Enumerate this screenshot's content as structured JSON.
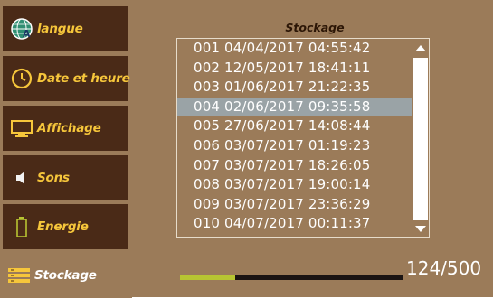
{
  "sidebar": {
    "items": [
      {
        "label": "langue",
        "icon": "globe-language-icon"
      },
      {
        "label": "Date et heure",
        "icon": "clock-icon"
      },
      {
        "label": "Affichage",
        "icon": "monitor-icon"
      },
      {
        "label": "Sons",
        "icon": "speaker-icon"
      },
      {
        "label": "Energie",
        "icon": "battery-icon"
      },
      {
        "label": "Stockage",
        "icon": "storage-list-icon",
        "active": true
      }
    ]
  },
  "main": {
    "title": "Stockage",
    "records": [
      "001 04/04/2017 04:55:42",
      "002 12/05/2017 18:41:11",
      "003 01/06/2017 21:22:35",
      "004 02/06/2017 09:35:58",
      "005 27/06/2017 14:08:44",
      "006 03/07/2017 01:19:23",
      "007 03/07/2017 18:26:05",
      "008 03/07/2017 19:00:14",
      "009 03/07/2017 23:36:29",
      "010 04/07/2017 00:11:37"
    ],
    "selected_index": 3,
    "storage": {
      "count_text": "124/500",
      "used": 124,
      "capacity": 500
    }
  },
  "colors": {
    "background": "#9b7b59",
    "sidebar_item": "#4a2a17",
    "label_gold": "#f6c63b",
    "selection": "#9aa3a6",
    "progress_fill": "#b7c432",
    "progress_track": "#1b1413"
  }
}
